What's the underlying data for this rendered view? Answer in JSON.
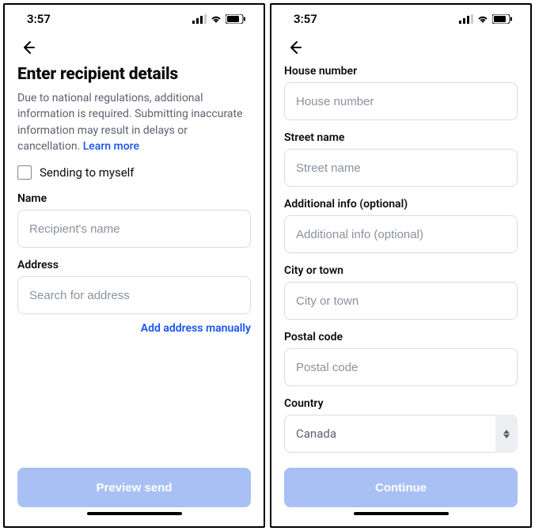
{
  "status": {
    "time": "3:57"
  },
  "left": {
    "title": "Enter recipient details",
    "subtext_a": "Due to national regulations, additional information is required. Submitting inaccurate information may result in delays or cancellation. ",
    "learn_more": "Learn more",
    "checkbox_label": "Sending to myself",
    "name_label": "Name",
    "name_placeholder": "Recipient's name",
    "address_label": "Address",
    "address_placeholder": "Search for address",
    "manual_link": "Add address manually",
    "cta": "Preview send"
  },
  "right": {
    "house_label": "House number",
    "house_placeholder": "House number",
    "street_label": "Street name",
    "street_placeholder": "Street name",
    "add_label": "Additional info (optional)",
    "add_placeholder": "Additional info (optional)",
    "city_label": "City or town",
    "city_placeholder": "City or town",
    "postal_label": "Postal code",
    "postal_placeholder": "Postal code",
    "country_label": "Country",
    "country_value": "Canada",
    "cta": "Continue"
  }
}
